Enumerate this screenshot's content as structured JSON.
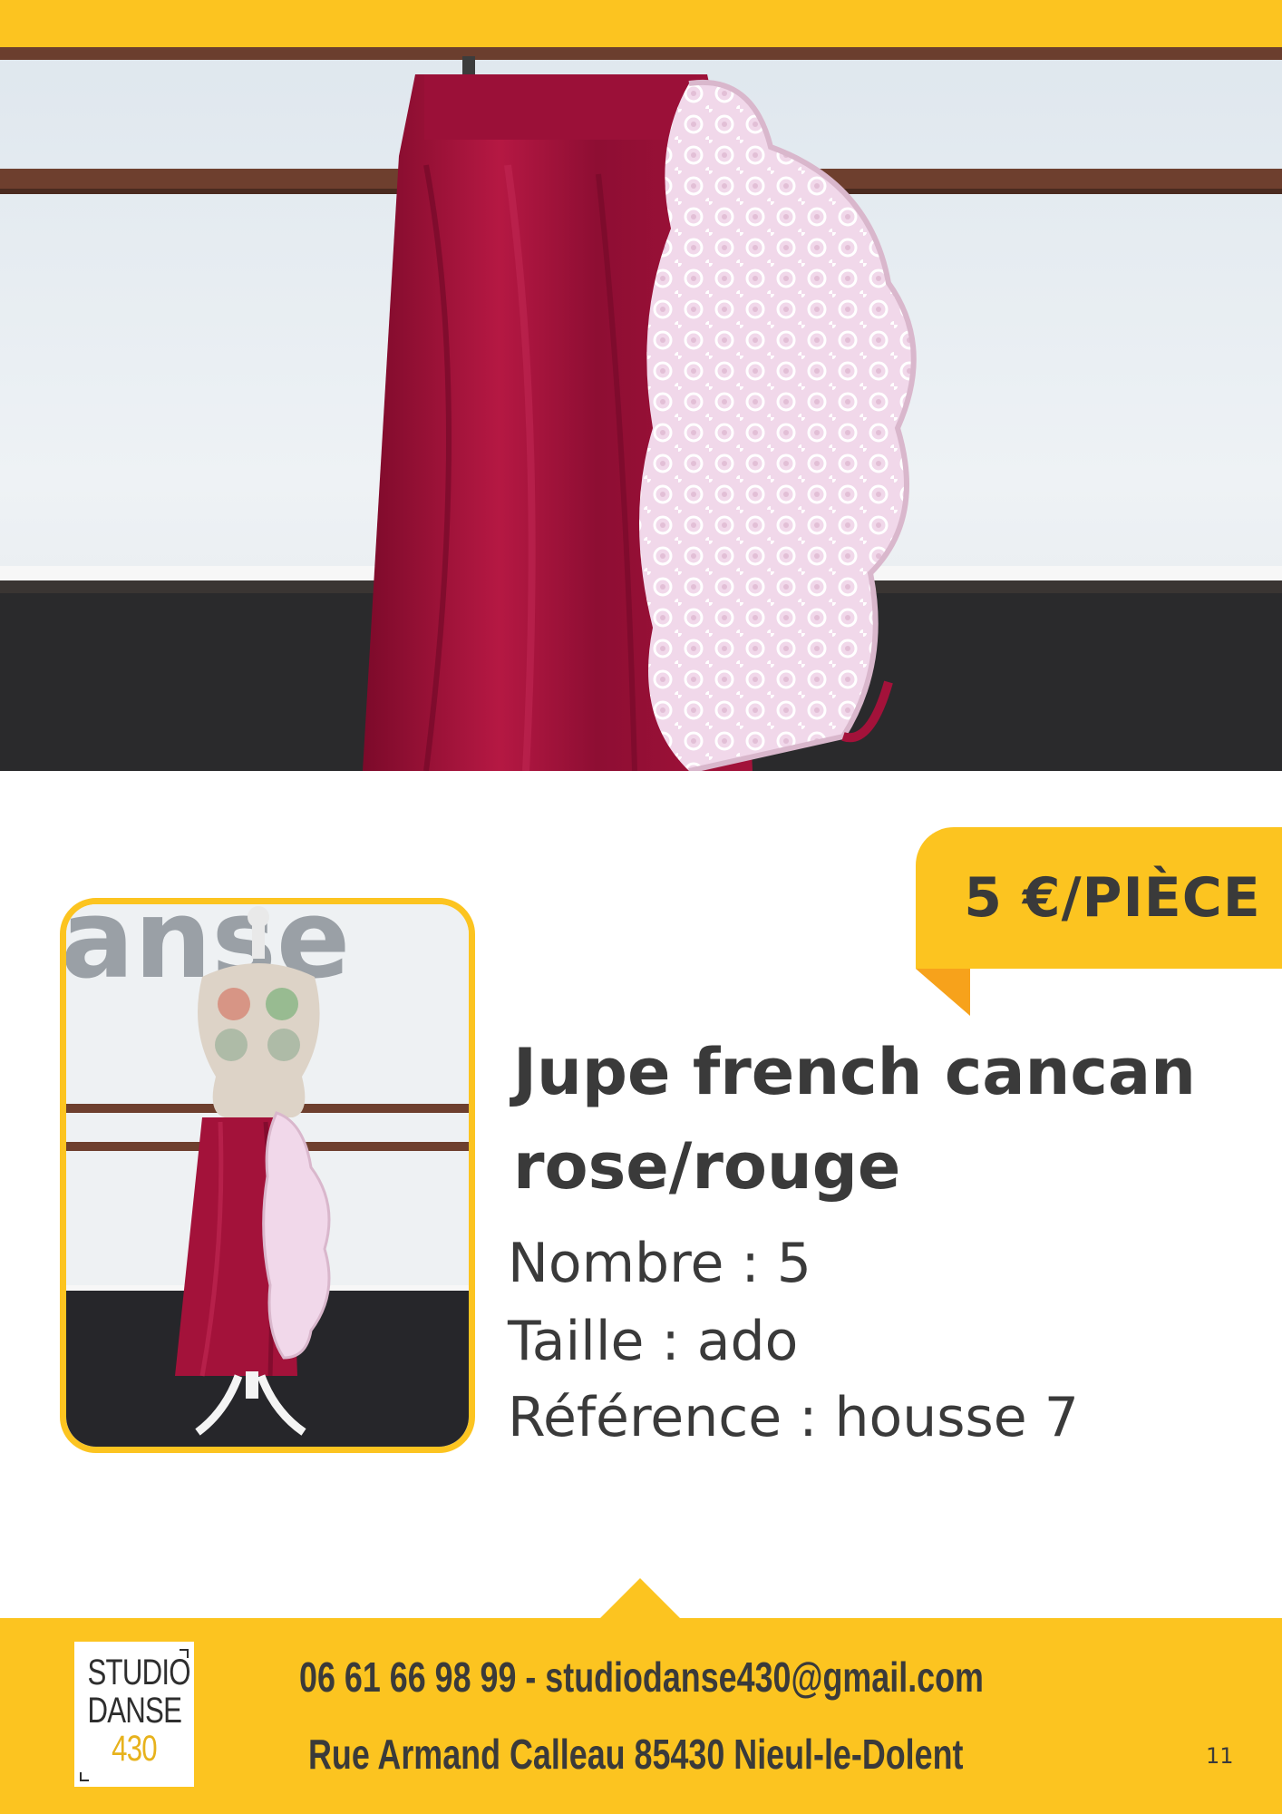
{
  "price": {
    "label": "5 €/PIÈCE"
  },
  "product": {
    "title_line1": "Jupe french cancan",
    "title_line2": "rose/rouge",
    "count": "Nombre : 5",
    "size": "Taille : ado",
    "reference": "Référence : housse 7"
  },
  "thumbnail": {
    "wall_text": "anse"
  },
  "footer": {
    "logo_line1": "STUDIO",
    "logo_line2": "DANSE",
    "logo_line3": "430",
    "contact_line1": "06 61 66 98 99 - studiodanse430@gmail.com",
    "contact_line2": "Rue Armand Calleau 85430 Nieul-le-Dolent",
    "page_number": "11"
  },
  "colors": {
    "accent": "#fcc420",
    "accent_dark": "#f7a21b",
    "text": "#3a3a3a",
    "skirt_red": "#a3123a",
    "lace_pink": "#f1d8ea"
  }
}
